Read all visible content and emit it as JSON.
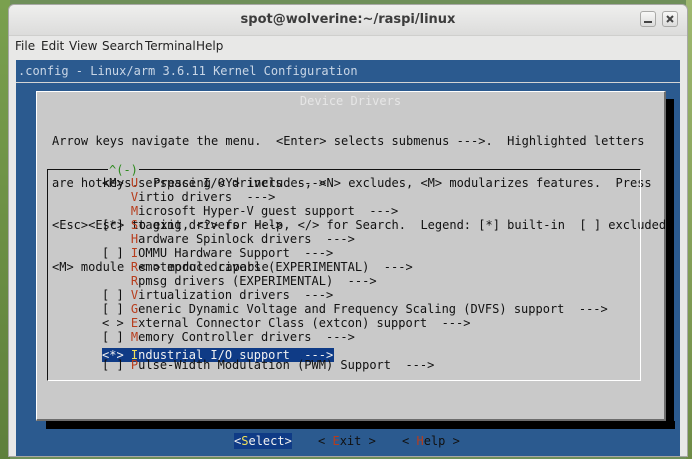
{
  "window": {
    "title": "spot@wolverine:~/raspi/linux"
  },
  "menubar": [
    "File",
    "Edit",
    "View",
    "Search",
    "Terminal",
    "Help"
  ],
  "config_title": ".config - Linux/arm 3.6.11 Kernel Configuration",
  "dialog": {
    "title": "Device Drivers",
    "help_lines": [
      "Arrow keys navigate the menu.  <Enter> selects submenus --->.  Highlighted letters",
      "are hotkeys.  Pressing <Y> includes, <N> excludes, <M> modularizes features.  Press",
      "<Esc><Esc> to exit, <?> for Help, </> for Search.  Legend: [*] built-in  [ ] excluded",
      "<M> module  < > module capable"
    ],
    "scroll_indicator": "^(-)",
    "items": [
      {
        "prefix": "<M> ",
        "hot": "U",
        "rest": "serspace I/O drivers  --->",
        "selected": false
      },
      {
        "prefix": "    ",
        "hot": "V",
        "rest": "irtio drivers  --->",
        "selected": false
      },
      {
        "prefix": "    ",
        "hot": "M",
        "rest": "icrosoft Hyper-V guest support  --->",
        "selected": false
      },
      {
        "prefix": "[*] ",
        "hot": "S",
        "rest": "taging drivers  --->",
        "selected": false
      },
      {
        "prefix": "    ",
        "hot": "H",
        "rest": "ardware Spinlock drivers  --->",
        "selected": false
      },
      {
        "prefix": "[ ] ",
        "hot": "I",
        "rest": "OMMU Hardware Support  --->",
        "selected": false
      },
      {
        "prefix": "    ",
        "hot": "R",
        "rest": "emoteproc drivers (EXPERIMENTAL)  --->",
        "selected": false
      },
      {
        "prefix": "    ",
        "hot": "R",
        "rest": "pmsg drivers (EXPERIMENTAL)  --->",
        "selected": false
      },
      {
        "prefix": "[ ] ",
        "hot": "V",
        "rest": "irtualization drivers  --->",
        "selected": false
      },
      {
        "prefix": "[ ] ",
        "hot": "G",
        "rest": "eneric Dynamic Voltage and Frequency Scaling (DVFS) support  --->",
        "selected": false
      },
      {
        "prefix": "< > ",
        "hot": "E",
        "rest": "xternal Connector Class (extcon) support  --->",
        "selected": false
      },
      {
        "prefix": "[ ] ",
        "hot": "M",
        "rest": "emory Controller drivers  --->",
        "selected": false
      },
      {
        "prefix": "<*> ",
        "hot": "I",
        "rest": "ndustrial I/O support  --->",
        "selected": true
      },
      {
        "prefix": "[ ] ",
        "hot": "P",
        "rest": "ulse-Width Modulation (PWM) Support  --->",
        "selected": false
      }
    ],
    "buttons": [
      {
        "pre": "<",
        "hot": "S",
        "rest": "elect>",
        "active": true
      },
      {
        "pre": "< ",
        "hot": "E",
        "rest": "xit >",
        "active": false
      },
      {
        "pre": "< ",
        "hot": "H",
        "rest": "elp >",
        "active": false
      }
    ]
  }
}
